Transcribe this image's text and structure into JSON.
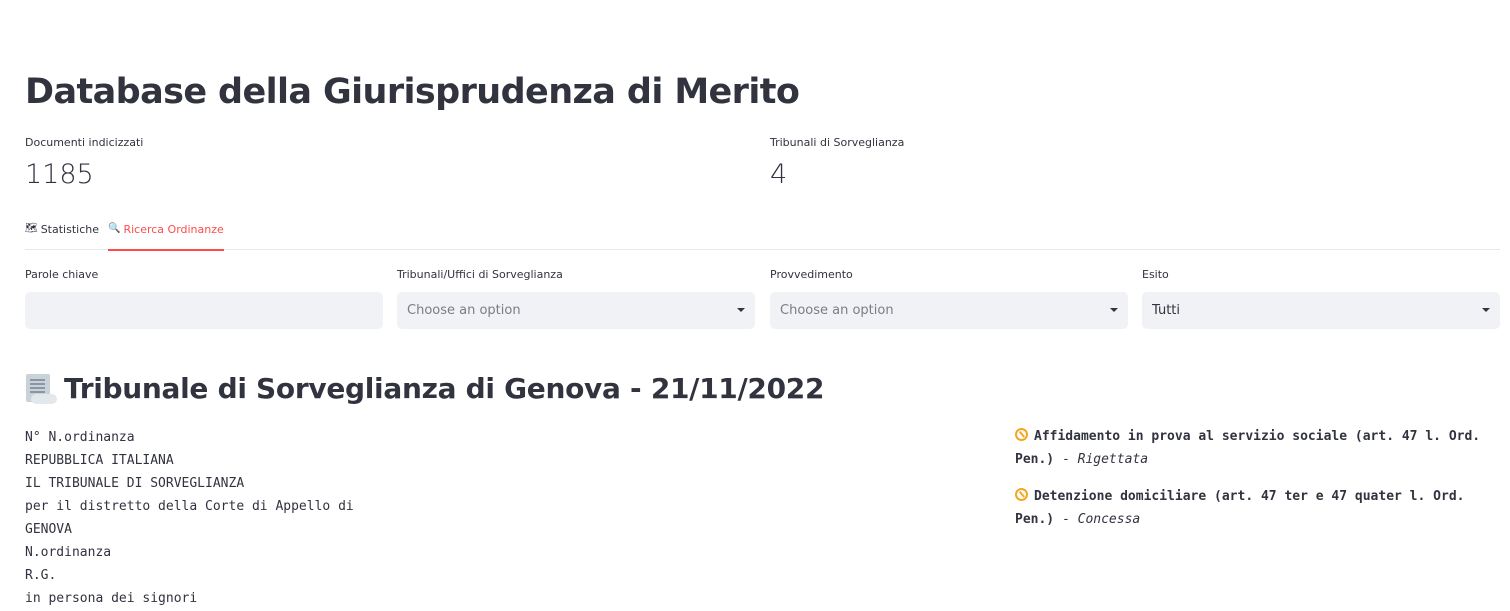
{
  "page": {
    "title": "Database della Giurisprudenza di Merito"
  },
  "metrics": [
    {
      "label": "Documenti indicizzati",
      "value": "1185"
    },
    {
      "label": "Tribunali di Sorveglianza",
      "value": "4"
    }
  ],
  "tabs": [
    {
      "icon": "map-icon",
      "icon_glyph": "🗺",
      "label": "Statistiche",
      "active": false
    },
    {
      "icon": "magnifier-icon",
      "icon_glyph": "🔍",
      "label": "Ricerca Ordinanze",
      "active": true
    }
  ],
  "filters": {
    "keywords": {
      "label": "Parole chiave",
      "value": ""
    },
    "tribunals": {
      "label": "Tribunali/Uffici di Sorveglianza",
      "placeholder": "Choose an option"
    },
    "measure": {
      "label": "Provvedimento",
      "placeholder": "Choose an option"
    },
    "outcome": {
      "label": "Esito",
      "value": "Tutti"
    }
  },
  "document": {
    "icon": "scroll-icon",
    "title": "Tribunale di Sorveglianza di Genova - 21/11/2022",
    "lines": [
      "N° N.ordinanza",
      "REPUBBLICA ITALIANA",
      "IL TRIBUNALE DI SORVEGLIANZA",
      "per il distretto della Corte di Appello di",
      "GENOVA",
      "N.ordinanza",
      "R.G.",
      "in persona dei signori"
    ],
    "outcomes": [
      {
        "icon": "compass-icon",
        "name": "Affidamento in prova al servizio sociale (art. 47 l. Ord. Pen.)",
        "separator": " - ",
        "result": "Rigettata"
      },
      {
        "icon": "compass-icon",
        "name": "Detenzione domiciliare (art. 47 ter e 47 quater l. Ord. Pen.)",
        "separator": " - ",
        "result": "Concessa"
      }
    ]
  },
  "colors": {
    "accent": "#ff4b4b",
    "input_background": "#f0f2f6",
    "text": "#31333f",
    "outcome_icon": "#f4a623"
  }
}
